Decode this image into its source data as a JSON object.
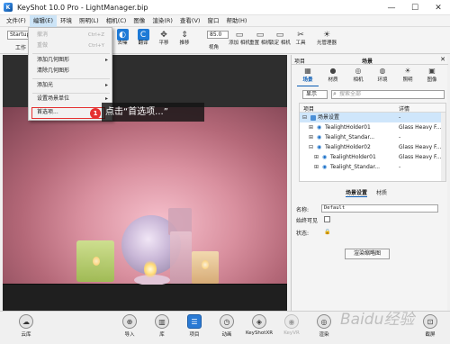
{
  "window": {
    "title": "KeyShot 10.0 Pro  -  LightManager.bip",
    "app_icon_letter": "K",
    "controls": [
      "—",
      "☐",
      "✕"
    ]
  },
  "menubar": [
    "文件(F)",
    "编辑(E)",
    "环境",
    "照明(L)",
    "相机(C)",
    "图像",
    "渲染(R)",
    "查看(V)",
    "窗口",
    "帮助(H)"
  ],
  "toolbar": {
    "startup_value": "Startup",
    "workspace_label": "工作",
    "buttons": [
      {
        "label": "去噪",
        "icon": "denoise-icon",
        "glyph": "◐"
      },
      {
        "label": "翻译",
        "icon": "refresh-icon",
        "glyph": "C"
      },
      {
        "label": "平移",
        "icon": "pan-icon",
        "glyph": "✥"
      },
      {
        "label": "推移",
        "icon": "dolly-icon",
        "glyph": "⇕"
      },
      {
        "label": "添加\n相机",
        "icon": "add-camera-icon",
        "glyph": "▭"
      },
      {
        "label": "重置\n相机",
        "icon": "reset-camera-icon",
        "glyph": "▭"
      },
      {
        "label": "锁定\n相机",
        "icon": "lock-camera-icon",
        "glyph": "▭"
      },
      {
        "label": "工具",
        "icon": "tools-icon",
        "glyph": "✂"
      },
      {
        "label": "光管理器",
        "icon": "light-manager-icon",
        "glyph": "☀"
      }
    ],
    "zoom_value": "85.0",
    "zoom_label": "视角"
  },
  "context_menu": {
    "items": [
      {
        "label": "撤消",
        "shortcut": "Ctrl+Z",
        "disabled": true
      },
      {
        "label": "重做",
        "shortcut": "Ctrl+Y",
        "disabled": true
      },
      {
        "label": "添加几何图形",
        "submenu": true
      },
      {
        "label": "清除几何图形"
      },
      {
        "label": "添加光",
        "submenu": true
      },
      {
        "label": "设置场景单位",
        "submenu": true
      },
      {
        "label": "首选项..."
      }
    ]
  },
  "callout": {
    "number": "1",
    "text": "点击“首选项...”"
  },
  "panel": {
    "left_label": "项目",
    "center_label": "场景",
    "close": "✕",
    "tabs": [
      {
        "label": "场景",
        "icon": "scene-icon",
        "glyph": "▦"
      },
      {
        "label": "材质",
        "icon": "material-icon",
        "glyph": "●"
      },
      {
        "label": "相机",
        "icon": "camera-icon",
        "glyph": "◎"
      },
      {
        "label": "环境",
        "icon": "environment-icon",
        "glyph": "◍"
      },
      {
        "label": "照明",
        "icon": "lighting-icon",
        "glyph": "☀"
      },
      {
        "label": "图像",
        "icon": "image-icon",
        "glyph": "▣"
      }
    ],
    "filter_value": "显示",
    "search_placeholder": "搜索全部",
    "tree": {
      "headers": [
        "项目",
        "详情"
      ],
      "rows": [
        {
          "name": "场景设置",
          "detail": "-",
          "selected": true,
          "indent": 0
        },
        {
          "name": "TealightHolder01",
          "detail": "Glass Heavy F...",
          "indent": 1
        },
        {
          "name": "Tealight_Standar...",
          "detail": "-",
          "indent": 1
        },
        {
          "name": "TealightHolder02",
          "detail": "Glass Heavy F...",
          "indent": 1
        },
        {
          "name": "TealightHolder01",
          "detail": "Glass Heavy F...",
          "indent": 2
        },
        {
          "name": "Tealight_Standar...",
          "detail": "-",
          "indent": 2
        }
      ]
    },
    "subtabs": [
      "场景设置",
      "材质"
    ],
    "props": {
      "name_label": "名称:",
      "name_value": "Default",
      "visible_label": "始终可见",
      "status_label": "状态:",
      "render_button": "渲染缩略图"
    }
  },
  "bottombar": {
    "buttons": [
      {
        "label": "云库",
        "icon": "cloud-library-icon",
        "glyph": "☁"
      },
      {
        "label": "导入",
        "icon": "import-icon",
        "glyph": "⊕"
      },
      {
        "label": "库",
        "icon": "library-icon",
        "glyph": "▥"
      },
      {
        "label": "项目",
        "icon": "project-icon",
        "glyph": "☰",
        "active": true
      },
      {
        "label": "动画",
        "icon": "animation-icon",
        "glyph": "◷"
      },
      {
        "label": "KeyShotXR",
        "icon": "keyshotxr-icon",
        "glyph": "◈"
      },
      {
        "label": "KeyVR",
        "icon": "keyvr-icon",
        "glyph": "◉",
        "dim": true
      },
      {
        "label": "渲染",
        "icon": "render-icon",
        "glyph": "◎"
      },
      {
        "label": "截屏",
        "icon": "screenshot-icon",
        "glyph": "⊡"
      }
    ]
  },
  "watermark": "Baidu经验"
}
